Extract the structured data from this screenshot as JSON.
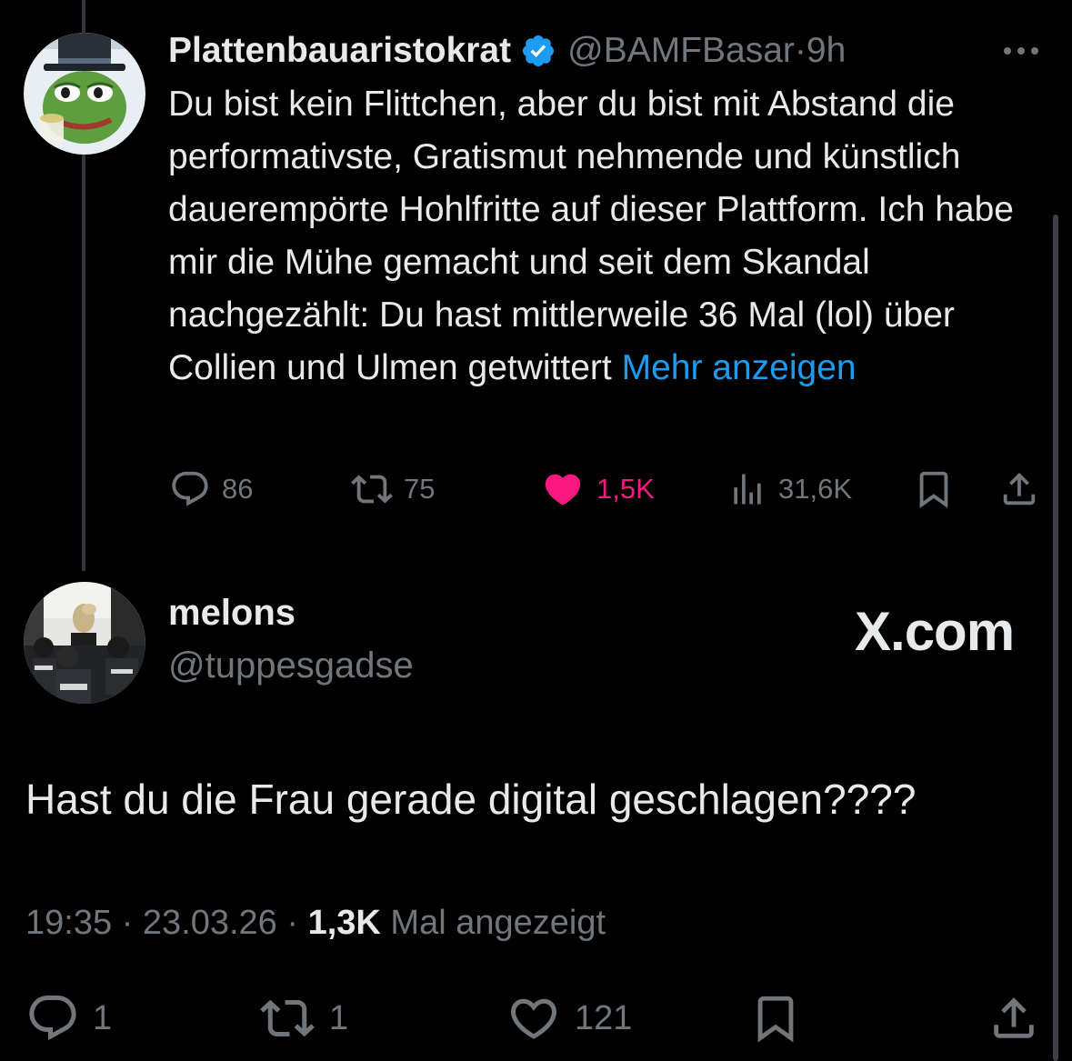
{
  "colors": {
    "background": "#000000",
    "text_primary": "#e7e9ea",
    "text_secondary": "#71767b",
    "link": "#1d9bf0",
    "like_active": "#f91880",
    "verified": "#1d9bf0"
  },
  "parent_tweet": {
    "display_name": "Plattenbauaristokrat",
    "verified": true,
    "handle": "@BAMFBasar",
    "separator": "·",
    "time_ago": "9h",
    "text": "Du bist kein Flittchen, aber du bist mit Abstand die performativste, Gratismut nehmende und künstlich dauerempörte Hohlfritte auf dieser Plattform. Ich habe mir die Mühe gemacht und seit dem Skandal nachgezählt: Du hast mittlerweile 36 Mal (lol) über Collien und Ulmen getwittert",
    "show_more_label": "Mehr anzeigen",
    "actions": {
      "replies": "86",
      "retweets": "75",
      "likes": "1,5K",
      "liked": true,
      "views": "31,6K"
    },
    "icons": [
      "reply-icon",
      "retweet-icon",
      "heart-filled-icon",
      "views-icon",
      "bookmark-icon",
      "share-icon",
      "more-icon",
      "verified-badge-icon"
    ]
  },
  "reply_tweet": {
    "display_name": "melons",
    "handle": "@tuppesgadse",
    "watermark": "X.com",
    "text": "Hast du die Frau gerade digital geschlagen????",
    "time": "19:35",
    "date": "23.03.26",
    "separator": "·",
    "views_count": "1,3K",
    "views_label": "Mal angezeigt",
    "actions": {
      "replies": "1",
      "retweets": "1",
      "likes": "121"
    },
    "icons": [
      "reply-icon",
      "retweet-icon",
      "heart-outline-icon",
      "bookmark-icon",
      "share-icon"
    ]
  }
}
